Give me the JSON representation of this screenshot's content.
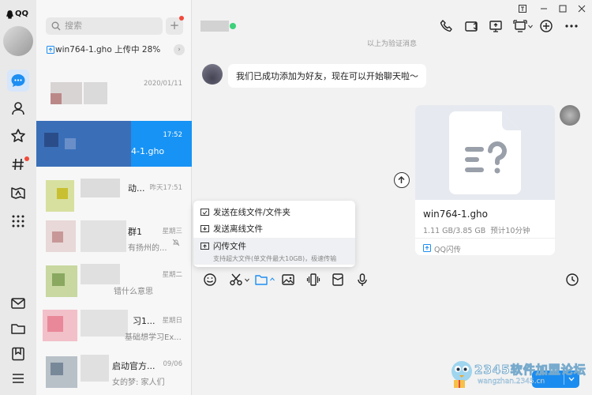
{
  "nav": {
    "app_name": "QQ"
  },
  "list": {
    "search_placeholder": "搜索",
    "add_label": "+",
    "upload_status": "win764-1.gho 上传中 28%",
    "conversations": [
      {
        "name": "",
        "preview": "",
        "time": "2020/01/11"
      },
      {
        "name": "4-1.gho",
        "preview": "",
        "time": "17:52"
      },
      {
        "name": "动...",
        "preview": "",
        "time": "昨天17:51"
      },
      {
        "name": "群1",
        "preview": "有扬州的...",
        "time": "星期三"
      },
      {
        "name": "",
        "preview": "错什么意思",
        "time": "星期二"
      },
      {
        "name": "习1...",
        "preview": "基础想学习Ex...",
        "time": "星期日"
      },
      {
        "name": "启动官方...",
        "preview": "女的梦: 家人们",
        "time": "09/06"
      }
    ]
  },
  "chat": {
    "system_note": "以上为验证消息",
    "peer_message": "我们已成功添加为好友，现在可以开始聊天啦～",
    "file": {
      "name": "win764-1.gho",
      "size": "1.11 GB/3.85 GB",
      "eta": "预计10分钟",
      "source": "QQ闪传"
    },
    "menu": [
      {
        "label": "发送在线文件/文件夹"
      },
      {
        "label": "发送离线文件"
      },
      {
        "label": "闪传文件",
        "sub": "支持超大文件(单文件最大10GB)，极速传输"
      }
    ]
  },
  "watermark": {
    "title": "2345软件加盟论坛",
    "url": "wangzhan.2345.cn"
  },
  "colors": {
    "accent": "#1793f5",
    "send": "#1a8cf0",
    "alert": "#f24a3a"
  }
}
